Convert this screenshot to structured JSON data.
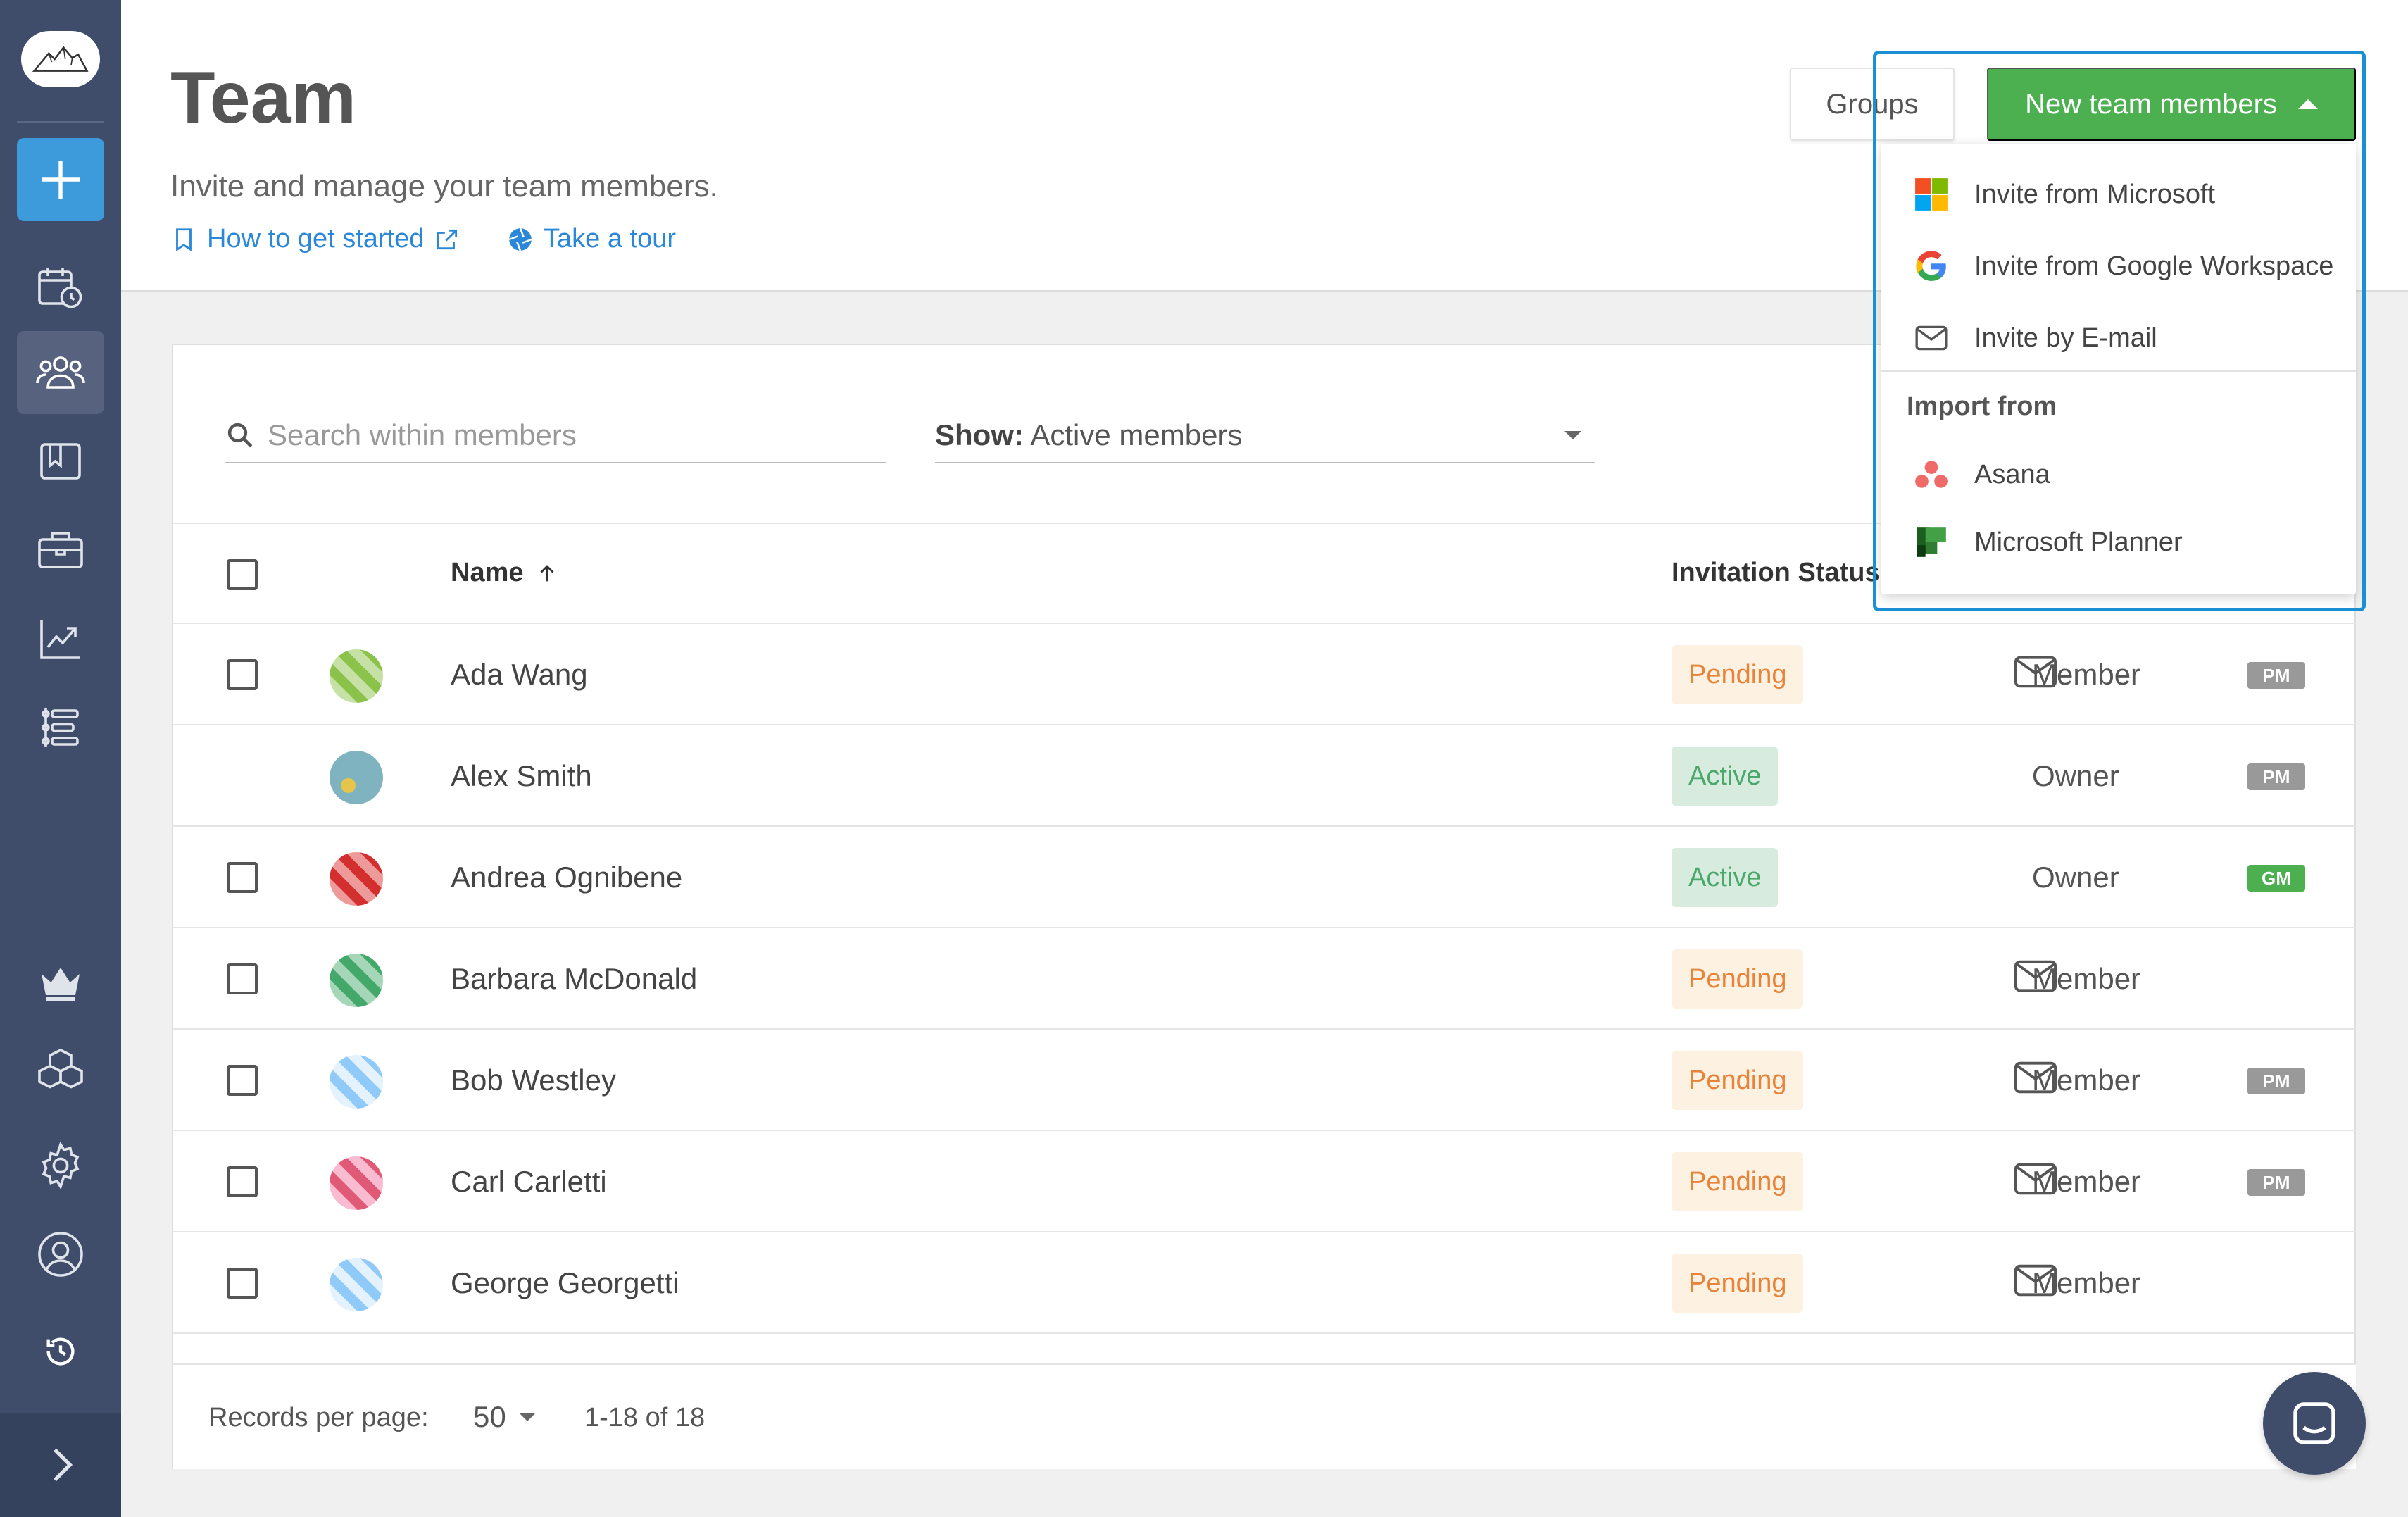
{
  "header": {
    "title": "Team",
    "subtitle": "Invite and manage your team members.",
    "help_link": "How to get started",
    "tour_link": "Take a tour",
    "groups_label": "Groups",
    "new_members_label": "New team members"
  },
  "filters": {
    "search_placeholder": "Search within members",
    "show_label": "Show:",
    "show_value": "Active members"
  },
  "table": {
    "columns": {
      "name": "Name",
      "invitation_status": "Invitation Status"
    },
    "rows": [
      {
        "name": "Ada Wang",
        "status": "Pending",
        "role": "Member",
        "tag": "PM",
        "avatar_color": "#8bc34a"
      },
      {
        "name": "Alex Smith",
        "status": "Active",
        "role": "Owner",
        "tag": "PM",
        "avatar_color": "#6aa7b5"
      },
      {
        "name": "Andrea Ognibene",
        "status": "Active",
        "role": "Owner",
        "tag": "GM",
        "avatar_color": "#d32f2f"
      },
      {
        "name": "Barbara McDonald",
        "status": "Pending",
        "role": "Member",
        "tag": "",
        "avatar_color": "#43a86a"
      },
      {
        "name": "Bob Westley",
        "status": "Pending",
        "role": "Member",
        "tag": "PM",
        "avatar_color": "#90caf9"
      },
      {
        "name": "Carl Carletti",
        "status": "Pending",
        "role": "Member",
        "tag": "PM",
        "avatar_color": "#e05a78"
      },
      {
        "name": "George Georgetti",
        "status": "Pending",
        "role": "Member",
        "tag": "",
        "avatar_color": "#90caf9"
      }
    ]
  },
  "footer": {
    "records_label": "Records per page:",
    "records_value": "50",
    "range": "1-18 of 18"
  },
  "dropdown": {
    "items": [
      {
        "label": "Invite from Microsoft",
        "icon": "microsoft-icon"
      },
      {
        "label": "Invite from Google Workspace",
        "icon": "google-icon"
      },
      {
        "label": "Invite by E-mail",
        "icon": "mail-icon"
      }
    ],
    "section_label": "Import from",
    "import_items": [
      {
        "label": "Asana",
        "icon": "asana-icon"
      },
      {
        "label": "Microsoft Planner",
        "icon": "planner-icon"
      }
    ]
  },
  "colors": {
    "sidebar": "#3f4d6b",
    "accent_green": "#4caf50",
    "link_blue": "#2b88d8",
    "highlight": "#1a8fd1"
  }
}
